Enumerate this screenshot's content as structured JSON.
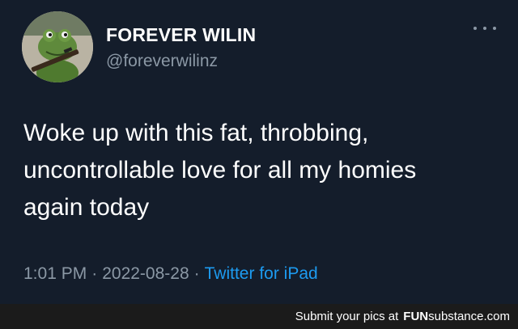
{
  "tweet": {
    "author_name": "FOREVER WILIN",
    "author_handle": "@foreverwilinz",
    "avatar_icon": "frog-avatar-icon",
    "more_icon": "more-options-icon",
    "text_lines": [
      "Woke up with this fat, throbbing,",
      "uncontrollable love for all my homies",
      "again today"
    ],
    "time": "1:01 PM",
    "separator": "·",
    "date": "2022-08-28",
    "client": "Twitter for iPad"
  },
  "footer": {
    "prefix": "Submit your pics at",
    "brand_bold": "FUN",
    "brand_rest": "substance.com"
  },
  "colors": {
    "background": "#141d2b",
    "text": "#ffffff",
    "muted": "#8b98a5",
    "link": "#1d9bf0",
    "footer_bg": "#1b1b1b"
  }
}
